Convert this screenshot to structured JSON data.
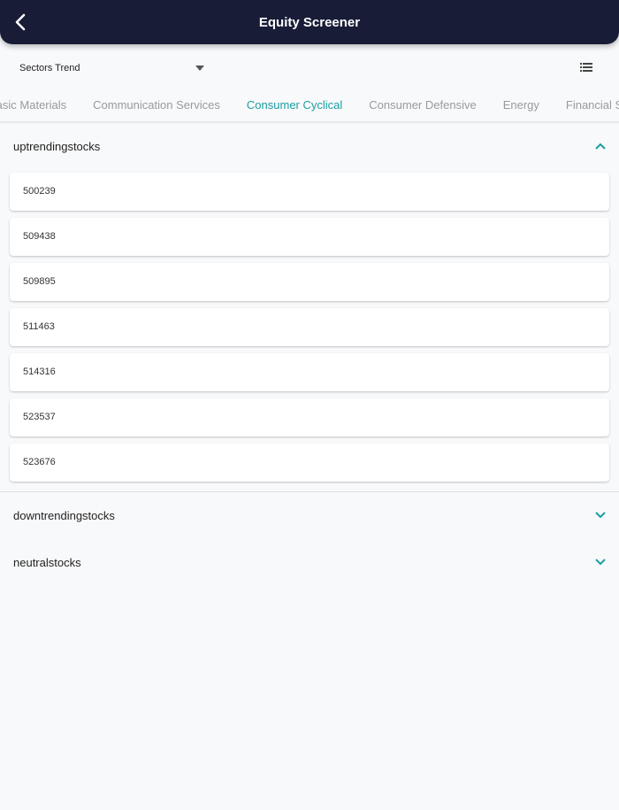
{
  "header": {
    "title": "Equity Screener",
    "back_icon": "chevron-left-icon"
  },
  "selector": {
    "value": "Sectors Trend",
    "icon": "caret-down-icon"
  },
  "view_icon": "list-icon",
  "tabs": [
    {
      "label": "Basic Materials",
      "active": false
    },
    {
      "label": "Communication Services",
      "active": false
    },
    {
      "label": "Consumer Cyclical",
      "active": true
    },
    {
      "label": "Consumer Defensive",
      "active": false
    },
    {
      "label": "Energy",
      "active": false
    },
    {
      "label": "Financial Services",
      "active": false
    }
  ],
  "sections": [
    {
      "title": "uptrendingstocks",
      "expanded": true,
      "items": [
        "500239",
        "509438",
        "509895",
        "511463",
        "514316",
        "523537",
        "523676"
      ]
    },
    {
      "title": "downtrendingstocks",
      "expanded": false,
      "items": []
    },
    {
      "title": "neutralstocks",
      "expanded": false,
      "items": []
    }
  ],
  "colors": {
    "appbar": "#181c37",
    "accent": "#1a9ea1"
  }
}
